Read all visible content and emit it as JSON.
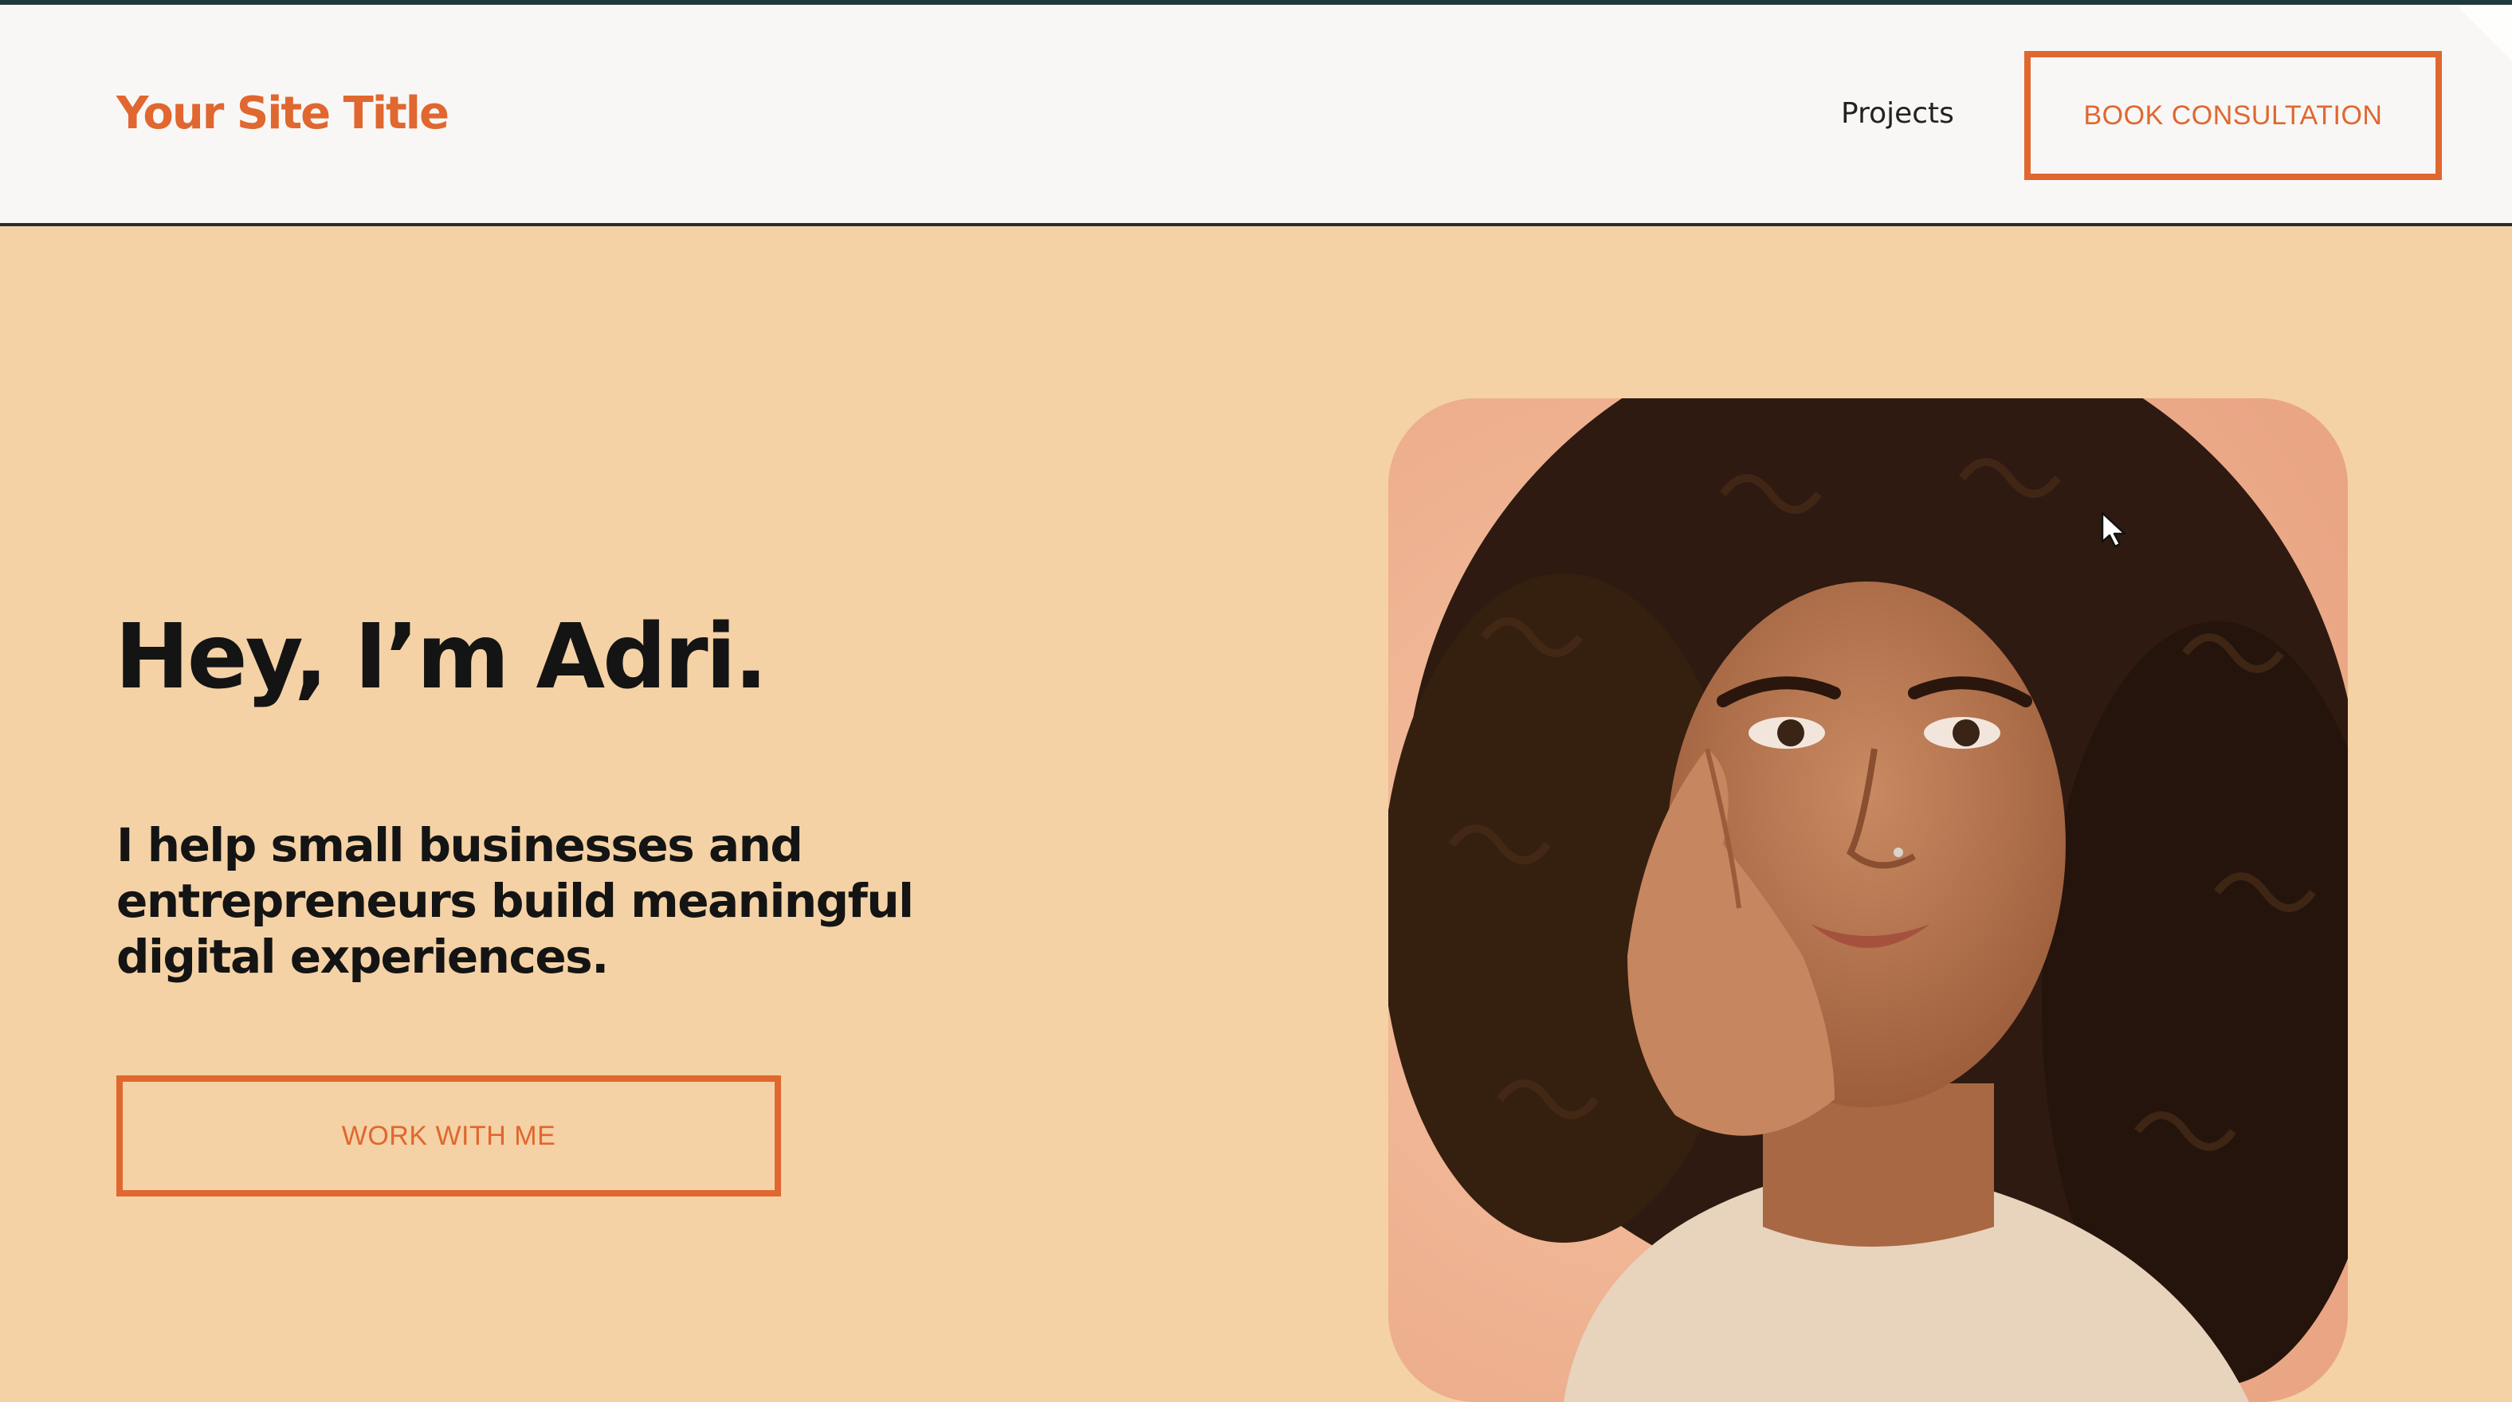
{
  "header": {
    "site_title": "Your Site Title",
    "nav": [
      {
        "label": "Projects"
      }
    ],
    "cta_label": "BOOK CONSULTATION"
  },
  "hero": {
    "title": "Hey, I’m Adri.",
    "subtitle": "I help small businesses and entrepreneurs build meaningful digital experiences.",
    "cta_label": "WORK WITH ME"
  },
  "colors": {
    "accent": "#e0672f",
    "header_bg": "#f8f7f5",
    "hero_bg": "#f4d2a5",
    "text": "#141414"
  },
  "icons": {
    "cursor": "mouse-pointer-icon"
  }
}
